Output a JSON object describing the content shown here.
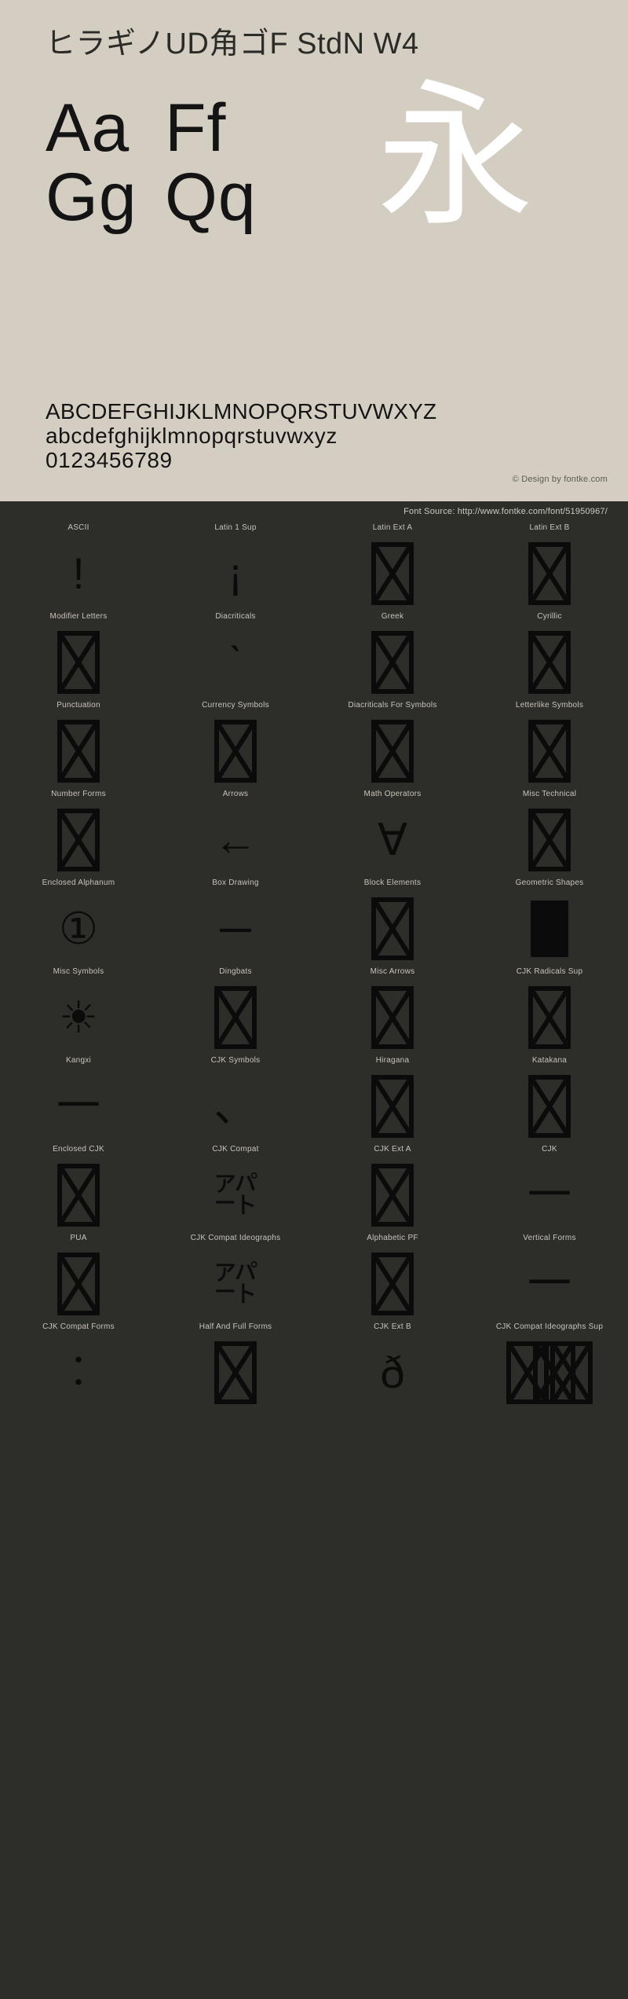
{
  "specimen": {
    "font_title": "ヒラギノUD角ゴF StdN W4",
    "sample_pairs": [
      {
        "a": "Aa",
        "b": "Ff"
      },
      {
        "a": "Gg",
        "b": "Qq"
      }
    ],
    "kanji_sample": "永",
    "uppercase": "ABCDEFGHIJKLMNOPQRSTUVWXYZ",
    "lowercase": "abcdefghijklmnopqrstuvwxyz",
    "digits": "0123456789",
    "copyright": "© Design by fontke.com"
  },
  "source_bar": {
    "text": "Font Source: http://www.fontke.com/font/51950967/"
  },
  "blocks": [
    {
      "label": "ASCII",
      "glyph": "!",
      "type": "text",
      "size": "normal"
    },
    {
      "label": "Latin 1 Sup",
      "glyph": "¡",
      "type": "text",
      "size": "normal"
    },
    {
      "label": "Latin Ext A",
      "glyph": "",
      "type": "tofu",
      "size": "normal"
    },
    {
      "label": "Latin Ext B",
      "glyph": "",
      "type": "tofu",
      "size": "normal"
    },
    {
      "label": "Modifier Letters",
      "glyph": "",
      "type": "tofu",
      "size": "normal"
    },
    {
      "label": "Diacriticals",
      "glyph": "ˋ",
      "type": "text",
      "size": "normal"
    },
    {
      "label": "Greek",
      "glyph": "",
      "type": "tofu",
      "size": "normal"
    },
    {
      "label": "Cyrillic",
      "glyph": "",
      "type": "tofu",
      "size": "normal"
    },
    {
      "label": "Punctuation",
      "glyph": "",
      "type": "tofu",
      "size": "normal"
    },
    {
      "label": "Currency Symbols",
      "glyph": "",
      "type": "tofu",
      "size": "normal"
    },
    {
      "label": "Diacriticals For Symbols",
      "glyph": "",
      "type": "tofu",
      "size": "normal"
    },
    {
      "label": "Letterlike Symbols",
      "glyph": "",
      "type": "tofu",
      "size": "normal"
    },
    {
      "label": "Number Forms",
      "glyph": "",
      "type": "tofu",
      "size": "normal"
    },
    {
      "label": "Arrows",
      "glyph": "←",
      "type": "text",
      "size": "normal"
    },
    {
      "label": "Math Operators",
      "glyph": "∀",
      "type": "text",
      "size": "normal"
    },
    {
      "label": "Misc Technical",
      "glyph": "",
      "type": "tofu",
      "size": "normal"
    },
    {
      "label": "Enclosed Alphanum",
      "glyph": "①",
      "type": "text",
      "size": "normal"
    },
    {
      "label": "Box Drawing",
      "glyph": "─",
      "type": "text",
      "size": "normal"
    },
    {
      "label": "Block Elements",
      "glyph": "",
      "type": "tofu",
      "size": "normal"
    },
    {
      "label": "Geometric Shapes",
      "glyph": "",
      "type": "filled",
      "size": "normal"
    },
    {
      "label": "Misc Symbols",
      "glyph": "☀",
      "type": "text",
      "size": "normal"
    },
    {
      "label": "Dingbats",
      "glyph": "",
      "type": "tofu",
      "size": "normal"
    },
    {
      "label": "Misc Arrows",
      "glyph": "",
      "type": "tofu",
      "size": "normal"
    },
    {
      "label": "CJK Radicals Sup",
      "glyph": "",
      "type": "tofu",
      "size": "normal"
    },
    {
      "label": "Kangxi",
      "glyph": "⼀",
      "type": "text",
      "size": "normal"
    },
    {
      "label": "CJK Symbols",
      "glyph": "、",
      "type": "text",
      "size": "normal"
    },
    {
      "label": "Hiragana",
      "glyph": "",
      "type": "tofu",
      "size": "normal"
    },
    {
      "label": "Katakana",
      "glyph": "",
      "type": "tofu",
      "size": "normal"
    },
    {
      "label": "Enclosed CJK",
      "glyph": "",
      "type": "tofu",
      "size": "normal"
    },
    {
      "label": "CJK Compat",
      "glyph": "㌀",
      "type": "text",
      "size": "normal"
    },
    {
      "label": "CJK Ext A",
      "glyph": "",
      "type": "tofu",
      "size": "normal"
    },
    {
      "label": "CJK",
      "glyph": "一",
      "type": "text",
      "size": "normal"
    },
    {
      "label": "PUA",
      "glyph": "",
      "type": "tofu",
      "size": "normal"
    },
    {
      "label": "CJK Compat Ideographs",
      "glyph": "㌀",
      "type": "text",
      "size": "normal"
    },
    {
      "label": "Alphabetic PF",
      "glyph": "",
      "type": "tofu",
      "size": "normal"
    },
    {
      "label": "Vertical Forms",
      "glyph": "一",
      "type": "text",
      "size": "normal"
    },
    {
      "label": "CJK Compat Forms",
      "glyph": "︰",
      "type": "text",
      "size": "normal"
    },
    {
      "label": "Half And Full Forms",
      "glyph": "",
      "type": "tofu",
      "size": "normal"
    },
    {
      "label": "CJK Ext B",
      "glyph": "ð",
      "type": "text",
      "size": "normal"
    },
    {
      "label": "CJK Compat Ideographs Sup",
      "glyph": "",
      "type": "tofu-overlap",
      "size": "normal"
    }
  ]
}
